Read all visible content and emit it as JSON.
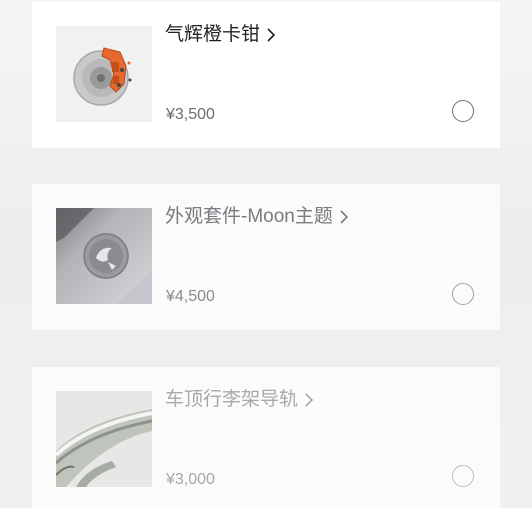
{
  "products": [
    {
      "title": "气辉橙卡钳",
      "price": "¥3,500",
      "image_icon": "brake-caliper-icon",
      "selected": false
    },
    {
      "title": "外观套件-Moon主题",
      "price": "¥4,500",
      "image_icon": "moon-theme-wheel-logo-icon",
      "selected": false
    },
    {
      "title": "车顶行李架导轨",
      "price": "¥3,000",
      "image_icon": "roof-rack-rail-icon",
      "selected": false
    }
  ],
  "colors": {
    "accent_caliper": "#e8692e",
    "title_primary": "#222222",
    "price_text": "#6b6b72",
    "radio_border": "#6e6e74"
  }
}
